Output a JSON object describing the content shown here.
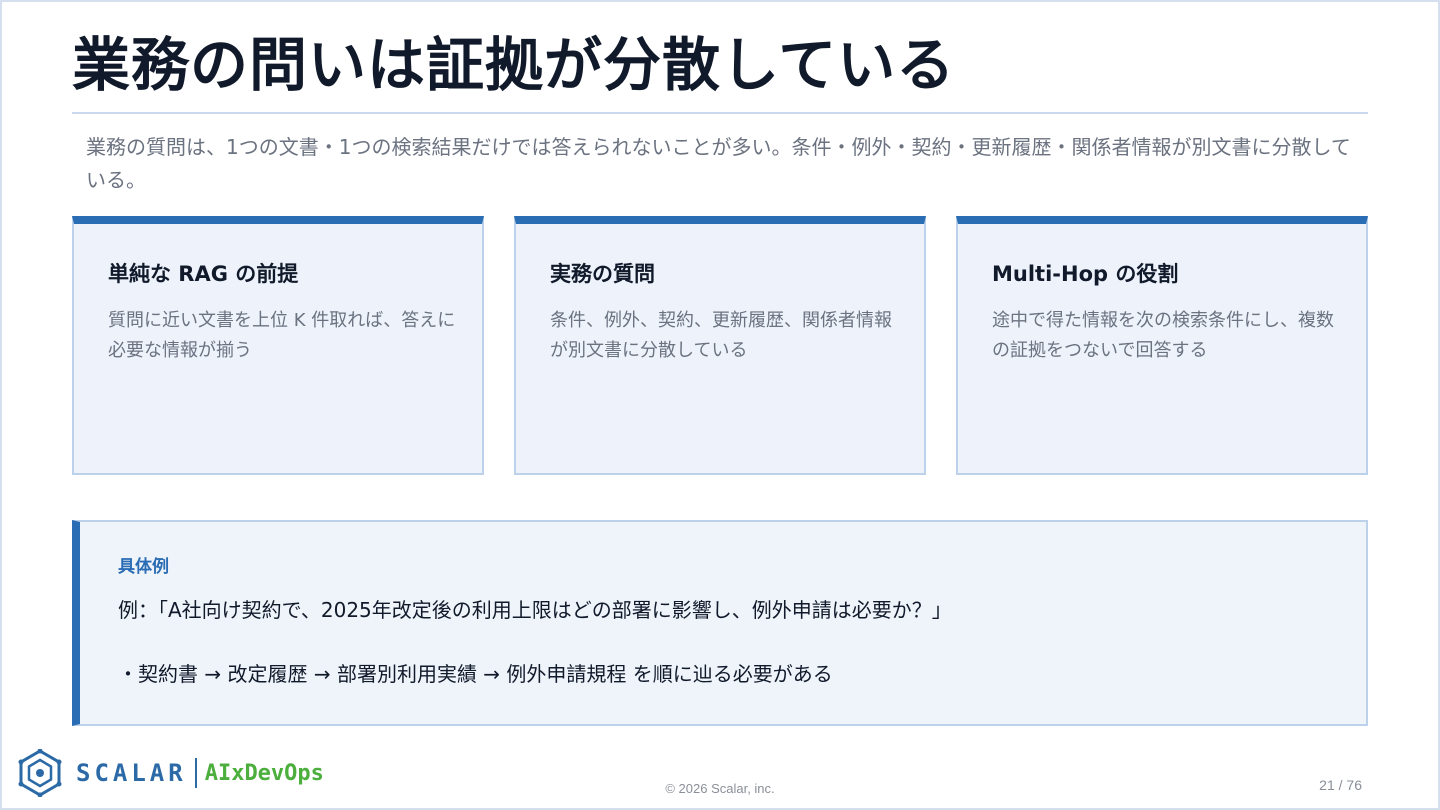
{
  "slide": {
    "title": "業務の問いは証拠が分散している",
    "lead": "業務の質問は、1つの文書・1つの検索結果だけでは答えられないことが多い。条件・例外・契約・更新履歴・関係者情報が別文書に分散している。"
  },
  "cards": [
    {
      "title": "単純な RAG の前提",
      "body": "質問に近い文書を上位 K 件取れば、答えに必要な情報が揃う"
    },
    {
      "title": "実務の質問",
      "body": "条件、例外、契約、更新履歴、関係者情報が別文書に分散している"
    },
    {
      "title": "Multi-Hop の役割",
      "body": "途中で得た情報を次の検索条件にし、複数の証拠をつないで回答する"
    }
  ],
  "example": {
    "label": "具体例",
    "question": "例：「A社向け契約で、2025年改定後の利用上限はどの部署に影響し、例外申請は必要か？」",
    "steps": "・契約書 → 改定履歴 → 部署別利用実績 → 例外申請規程 を順に辿る必要がある"
  },
  "footer": {
    "logo_word": "SCALAR",
    "logo_sub": "AIxDevOps",
    "copyright": "© 2026 Scalar, inc.",
    "page": "21 / 76"
  },
  "colors": {
    "accent": "#2a6db4",
    "card_bg": "#eef3fb",
    "logo_green": "#4caf3d"
  }
}
